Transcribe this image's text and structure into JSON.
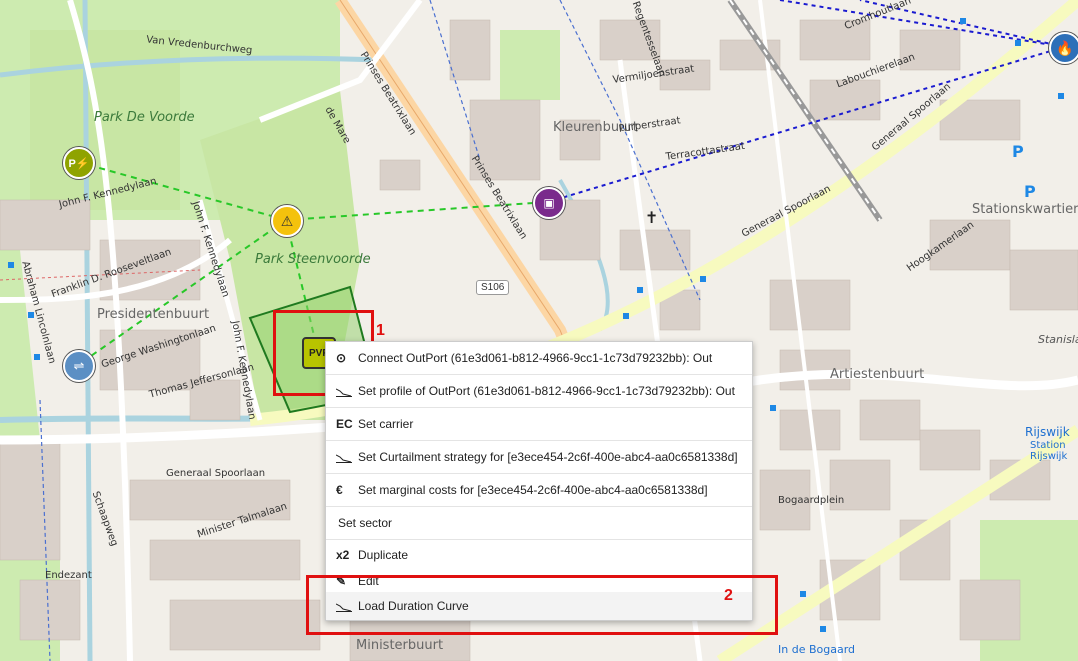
{
  "map": {
    "labels": {
      "park_de_voorde": "Park De Voorde",
      "park_steenvoorde": "Park Steenvoorde",
      "presidentenbuurt": "Presidentenbuurt",
      "kleurenbuurt": "Kleurenbuurt",
      "stationskwartier": "Stationskwartier",
      "artiestenbuurt": "Artiestenbuurt",
      "ministerbuurt": "Ministerbuurt",
      "stanislas": "Stanislas",
      "rijswijk": "Rijswijk",
      "station_rijswijk": "Station Rijswijk",
      "in_de_bogaard": "In de Bogaard",
      "van_vredenburchweg": "Van Vredenburchweg",
      "prinses_beatrixlaan": "Prinses Beatrixlaan",
      "prinses_beatrixlaan_2": "Prinses Beatrixlaan",
      "generaal_spoorlaan": "Generaal Spoorlaan",
      "generaal_spoorlaan_2": "Generaal Spoorlaan",
      "generaal_spoorlaan_3": "Generaal Spoorlaan",
      "john_f_kennedylaan": "John F. Kennedylaan",
      "john_f_kennedylaan_2": "John F. Kennedylaan",
      "john_f_kennedylaan_3": "John F. Kennedylaan",
      "franklin": "Franklin D. Rooseveltlaan",
      "abraham": "Abraham Lincolnlaan",
      "george": "George Washingtonlaan",
      "thomas": "Thomas Jeffersonlaan",
      "schaapweg": "Schaapweg",
      "minister_talmalaan": "Minister Talmalaan",
      "endezant": "Endezant",
      "cromhoutlaan": "Cromhoutlaan",
      "labouchierelaan": "Labouchierelaan",
      "regentesselaan": "Regentesselaan",
      "hoogkamerlaan": "Hoogkamerlaan",
      "bogaardplein": "Bogaardplein",
      "de_mare": "de Mare",
      "s106": "S106",
      "terracottastraat": "Terracottastraat",
      "purperstraat": "Purperstraat",
      "vermiljoenstraat": "Vermiljoenstraat"
    }
  },
  "markers": {
    "pv_label": "PVP"
  },
  "annotations": {
    "box1_label": "1",
    "box2_label": "2"
  },
  "context_menu": {
    "items": [
      {
        "icon": "connect-icon",
        "glyph": "⊙",
        "label": "Connect OutPort (61e3d061-b812-4966-9cc1-1c73d79232bb): Out"
      },
      {
        "icon": "profile-icon",
        "glyph": "",
        "label": "Set profile of OutPort (61e3d061-b812-4966-9cc1-1c73d79232bb): Out"
      },
      {
        "icon": "carrier-icon",
        "glyph": "EC",
        "label": "Set carrier"
      },
      {
        "icon": "curtailment-icon",
        "glyph": "",
        "label": "Set Curtailment strategy for [e3ece454-2c6f-400e-abc4-aa0c6581338d]"
      },
      {
        "icon": "euro-icon",
        "glyph": "€",
        "label": "Set marginal costs for [e3ece454-2c6f-400e-abc4-aa0c6581338d]"
      },
      {
        "icon": "",
        "glyph": "",
        "label": "Set sector"
      },
      {
        "icon": "duplicate-icon",
        "glyph": "x2",
        "label": "Duplicate"
      },
      {
        "icon": "edit-icon",
        "glyph": "✎",
        "label": "Edit"
      },
      {
        "icon": "load-duration-icon",
        "glyph": "",
        "label": "Load Duration Curve"
      }
    ]
  }
}
